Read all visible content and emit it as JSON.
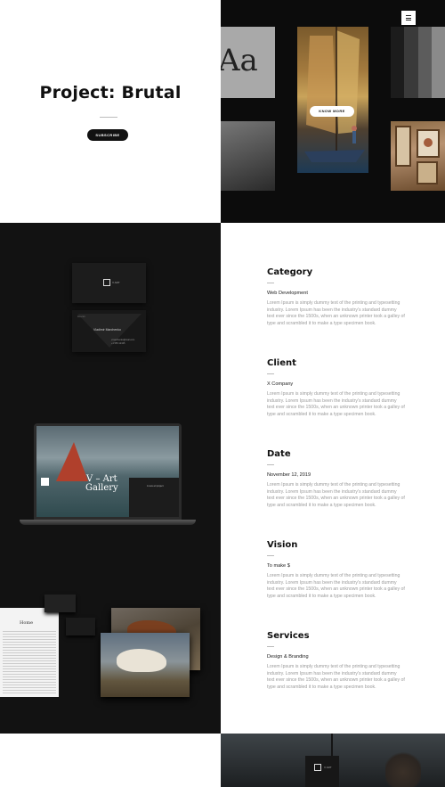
{
  "hero": {
    "title": "Project: Brutal",
    "subscribe_label": "SUBSCRIBE",
    "know_more_label": "KNOW MORE",
    "aa_text": "Aa",
    "stripe_colors": [
      "#1c1c1c",
      "#3a3a3a",
      "#5c5c5c",
      "#8a8a8a"
    ]
  },
  "mockups": {
    "card_logo_text": "V ART",
    "card_name": "Vladimir Marchenko",
    "card_label": "Director",
    "card_contact": "vmarchenko@mail.com\n+1 555 12345",
    "laptop_heading_line1": "V – Art",
    "laptop_heading_line2": "Gallery",
    "laptop_panel_text": "A new art project",
    "doc_heading": "Home"
  },
  "details": [
    {
      "title": "Category",
      "value": "Web Development",
      "body": "Lorem Ipsum is simply dummy text of the printing and typesetting industry. Lorem Ipsum has been the industry's standard dummy text ever since the 1500s, when an unknown printer took a galley of type and scrambled it to make a type specimen book."
    },
    {
      "title": "Client",
      "value": "X Company",
      "body": "Lorem Ipsum is simply dummy text of the printing and typesetting industry. Lorem Ipsum has been the industry's standard dummy text ever since the 1500s, when an unknown printer took a galley of type and scrambled it to make a type specimen book."
    },
    {
      "title": "Date",
      "value": "November 12, 2019",
      "body": "Lorem Ipsum is simply dummy text of the printing and typesetting industry. Lorem Ipsum has been the industry's standard dummy text ever since the 1500s, when an unknown printer took a galley of type and scrambled it to make a type specimen book."
    },
    {
      "title": "Vision",
      "value": "To make $",
      "body": "Lorem Ipsum is simply dummy text of the printing and typesetting industry. Lorem Ipsum has been the industry's standard dummy text ever since the 1500s, when an unknown printer took a galley of type and scrambled it to make a type specimen book."
    },
    {
      "title": "Services",
      "value": "Design & Branding",
      "body": "Lorem Ipsum is simply dummy text of the printing and typesetting industry. Lorem Ipsum has been the industry's standard dummy text ever since the 1500s, when an unknown printer took a galley of type and scrambled it to make a type specimen book."
    }
  ],
  "bottom": {
    "sign_text": "V ART"
  }
}
